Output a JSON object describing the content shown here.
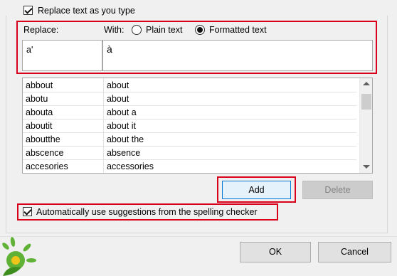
{
  "options": {
    "replace_as_you_type_label": "Replace text as you type",
    "auto_spelling_label": "Automatically use suggestions from the spelling checker"
  },
  "replace_section": {
    "replace_label": "Replace:",
    "with_label": "With:",
    "plain_text_label": "Plain text",
    "formatted_text_label": "Formatted text",
    "selected_option": "Formatted text",
    "replace_value": "a'",
    "with_value": "à"
  },
  "entries": [
    {
      "replace": "abbout",
      "with": "about"
    },
    {
      "replace": "abotu",
      "with": "about"
    },
    {
      "replace": "abouta",
      "with": "about a"
    },
    {
      "replace": "aboutit",
      "with": "about it"
    },
    {
      "replace": "aboutthe",
      "with": "about the"
    },
    {
      "replace": "abscence",
      "with": "absence"
    },
    {
      "replace": "accesories",
      "with": "accessories"
    }
  ],
  "buttons": {
    "add": "Add",
    "delete": "Delete",
    "ok": "OK",
    "cancel": "Cancel"
  },
  "colors": {
    "highlight_red": "#d9001b",
    "logo_green": "#5fb235",
    "logo_yellow": "#f0c419"
  }
}
